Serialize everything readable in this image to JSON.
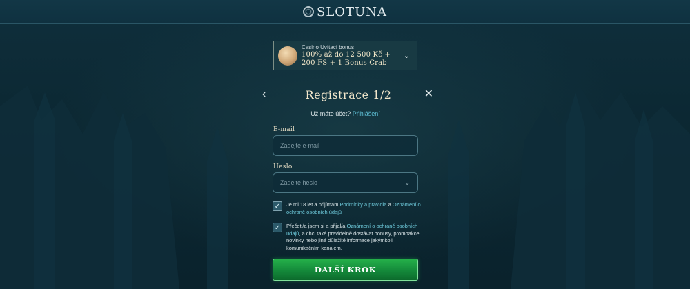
{
  "brand": {
    "logo_text": "SLOTUNA",
    "logo_icon": "slotuna-emblem-icon"
  },
  "bonus": {
    "label": "Casino Uvítací bonus",
    "title": "100% až do 12 500 Kč + 200 FS + 1 Bonus Crab",
    "chevron": "⌄"
  },
  "registration": {
    "title": "Registrace 1/2",
    "back_icon": "‹",
    "close_icon": "✕",
    "have_account_text": "Už máte účet?",
    "login_link": "Přihlášení"
  },
  "form": {
    "email_label": "E-mail",
    "email_placeholder": "Zadejte e-mail",
    "password_label": "Heslo",
    "password_placeholder": "Zadejte heslo",
    "eye_icon": "⌄"
  },
  "consents": [
    {
      "checked": true,
      "text_before": "Je mi 18 let a přijímám ",
      "link1": "Podmínky a pravidla",
      "text_mid": " a ",
      "link2": "Oznámení o ochraně osobních údajů",
      "text_after": ""
    },
    {
      "checked": true,
      "text_before": "Přečetl/a jsem si a přijal/a ",
      "link1": "Oznámení o ochraně osobních údajů",
      "text_after": ", a chci také pravidelně dostávat bonusy, promoakce, novinky nebo jiné důležité informace jakýmkoli komunikačním kanálem."
    }
  ],
  "cta_label": "DALŠÍ KROK",
  "colors": {
    "accent": "#5fc0d6",
    "cta": "#14893a",
    "background": "#0c2833"
  }
}
